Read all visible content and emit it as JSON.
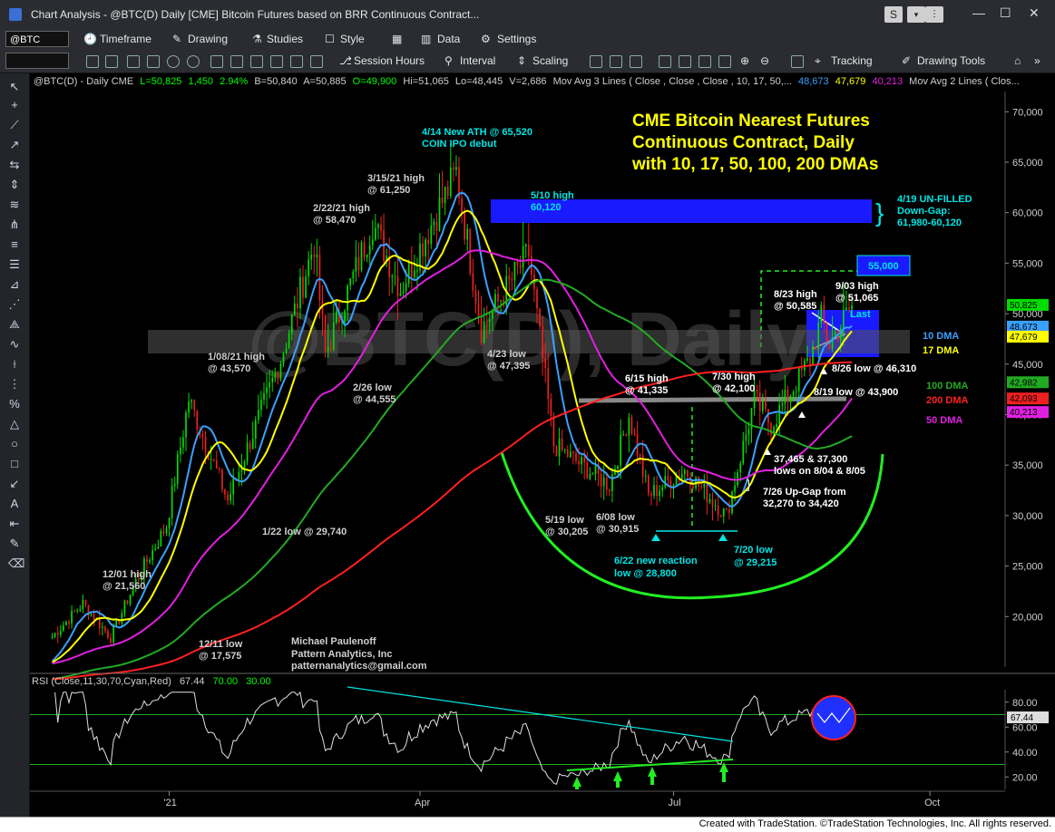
{
  "window": {
    "title": "Chart Analysis - @BTC(D) Daily [CME] Bitcoin Futures based on BRR Continuous Contract..."
  },
  "toolbar1": {
    "symbol": "@BTC",
    "timeframe": "Timeframe",
    "drawing": "Drawing",
    "studies": "Studies",
    "style": "Style",
    "data": "Data",
    "settings": "Settings"
  },
  "toolbar2": {
    "session_hours": "Session Hours",
    "interval": "Interval",
    "scaling": "Scaling",
    "tracking": "Tracking",
    "drawing_tools": "Drawing Tools"
  },
  "legend_line": {
    "sym": "@BTC(D) - Daily  CME",
    "last": "L=50,825",
    "chg": "1,450",
    "pct": "2.94%",
    "bid": "B=50,840",
    "ask": "A=50,885",
    "open": "O=49,900",
    "hi": "Hi=51,065",
    "lo": "Lo=48,445",
    "vol": "V=2,686",
    "mav3": "Mov Avg 3 Lines (  Close ,  Close ,  Close , 10, 17, 50,...",
    "v1": "48,673",
    "v2": "47,679",
    "v3": "40,213",
    "mav2": "Mov Avg 2 Lines (    Clos..."
  },
  "watermark": "@BTC(D), Daily",
  "headline": [
    "CME Bitcoin Nearest Futures",
    "Continuous Contract, Daily",
    "with 10, 17, 50, 100, 200 DMAs"
  ],
  "annotations": {
    "ath": [
      "4/14 New ATH @ 65,520",
      "COIN IPO debut"
    ],
    "h510": [
      "5/10 high",
      "60,120"
    ],
    "gap": [
      "4/19 UN-FILLED",
      "Down-Gap:",
      "61,980-60,120"
    ],
    "t55": "55,000",
    "h903": [
      "9/03 high",
      "@ 51,065"
    ],
    "h823": [
      "8/23 high",
      "@ 50,585"
    ],
    "last": "Last",
    "h315": [
      "3/15/21 high",
      "@ 61,250"
    ],
    "h222": [
      "2/22/21 high",
      "@ 58,470"
    ],
    "h108": [
      "1/08/21 high",
      "@ 43,570"
    ],
    "l423": [
      "4/23 low",
      "@ 47,395"
    ],
    "l226": [
      "2/26 low",
      "@ 44,555"
    ],
    "h615": [
      "6/15 high",
      "@ 41,335"
    ],
    "h730": [
      "7/30 high",
      "@ 42,100"
    ],
    "l826": "8/26 low @ 46,310",
    "l819": "8/19 low @ 43,900",
    "lows804": [
      "37,465 & 37,300",
      "lows on 8/04 & 8/05"
    ],
    "gap726": [
      "7/26 Up-Gap from",
      "32,270 to 34,420"
    ],
    "l122": "1/22 low @ 29,740",
    "l519": [
      "5/19 low",
      "@ 30,205"
    ],
    "l608": [
      "6/08 low",
      "@ 30,915"
    ],
    "l622": [
      "6/22 new reaction",
      "low @ 28,800"
    ],
    "l720": [
      "7/20 low",
      "@ 29,215"
    ],
    "h1201": [
      "12/01 high",
      "@ 21,560"
    ],
    "l1211": [
      "12/11 low",
      "@ 17,575"
    ],
    "author": [
      "Michael Paulenoff",
      "Pattern Analytics, Inc",
      "patternanalytics@gmail.com"
    ]
  },
  "dma_labels": [
    {
      "label": "10 DMA",
      "color": "#3aa0ff"
    },
    {
      "label": "17 DMA",
      "color": "#ffff00"
    },
    {
      "label": "100 DMA",
      "color": "#22aa22"
    },
    {
      "label": "200 DMA",
      "color": "#ff2020"
    },
    {
      "label": "50 DMA",
      "color": "#e020e0"
    }
  ],
  "rsi": {
    "label": "RSI (Close,11,30,70,Cyan,Red)",
    "value": "67.44",
    "ob": "70.00",
    "os": "30.00"
  },
  "x_labels": [
    "'21",
    "Apr",
    "Jul",
    "Oct"
  ],
  "price_badges": [
    "50,825",
    "48,673",
    "47,679",
    "42,982",
    "42,093",
    "40,213"
  ],
  "status": "Created with TradeStation. ©TradeStation Technologies, Inc. All rights reserved.",
  "chart_data": {
    "type": "line",
    "ylim": [
      15000,
      72000
    ],
    "y_ticks": [
      20000,
      25000,
      30000,
      35000,
      40000,
      45000,
      50000,
      55000,
      60000,
      65000,
      70000
    ],
    "y_tick_labels": [
      "20,000",
      "25,000",
      "30,000",
      "35,000",
      "40,000",
      "45,000",
      "50,000",
      "55,000",
      "60,000",
      "65,000",
      "70,000"
    ],
    "price_series": [
      {
        "date": "2020-11-20",
        "close": 18000
      },
      {
        "date": "2020-12-01",
        "close": 21300
      },
      {
        "date": "2020-12-11",
        "close": 17900
      },
      {
        "date": "2020-12-20",
        "close": 23500
      },
      {
        "date": "2020-12-31",
        "close": 29000
      },
      {
        "date": "2021-01-08",
        "close": 41500
      },
      {
        "date": "2021-01-22",
        "close": 31500
      },
      {
        "date": "2021-02-10",
        "close": 45500
      },
      {
        "date": "2021-02-22",
        "close": 57000
      },
      {
        "date": "2021-02-26",
        "close": 46000
      },
      {
        "date": "2021-03-15",
        "close": 59000
      },
      {
        "date": "2021-03-25",
        "close": 52500
      },
      {
        "date": "2021-04-14",
        "close": 64000
      },
      {
        "date": "2021-04-23",
        "close": 48500
      },
      {
        "date": "2021-05-10",
        "close": 56000
      },
      {
        "date": "2021-05-19",
        "close": 37000
      },
      {
        "date": "2021-06-08",
        "close": 33000
      },
      {
        "date": "2021-06-15",
        "close": 40000
      },
      {
        "date": "2021-06-22",
        "close": 32000
      },
      {
        "date": "2021-07-05",
        "close": 34500
      },
      {
        "date": "2021-07-20",
        "close": 30000
      },
      {
        "date": "2021-07-30",
        "close": 41500
      },
      {
        "date": "2021-08-05",
        "close": 39000
      },
      {
        "date": "2021-08-19",
        "close": 45500
      },
      {
        "date": "2021-08-23",
        "close": 49500
      },
      {
        "date": "2021-08-26",
        "close": 47000
      },
      {
        "date": "2021-09-03",
        "close": 50825
      }
    ],
    "rsi_ylim": [
      10,
      90
    ],
    "rsi_ticks": [
      20,
      40,
      60,
      80
    ],
    "rsi_tick_labels": [
      "20.00",
      "40.00",
      "60.00",
      "80.00"
    ]
  }
}
